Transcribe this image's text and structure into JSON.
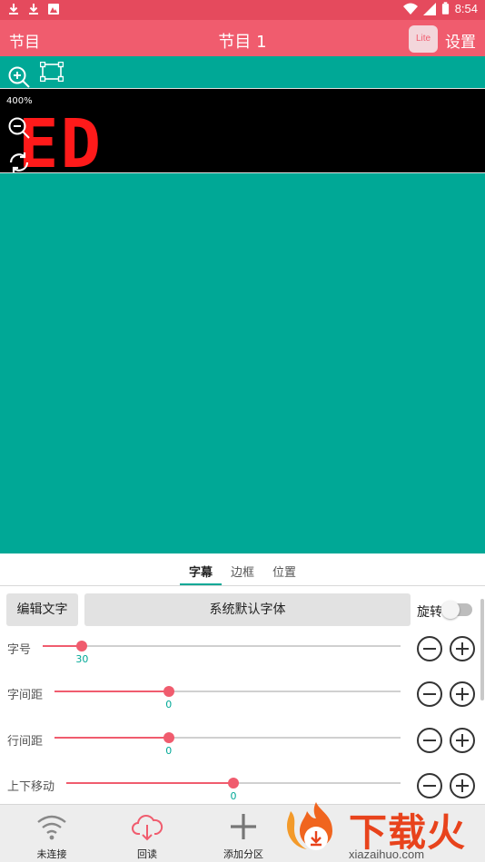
{
  "status_bar": {
    "time": "8:54",
    "left_icons": [
      "download-icon",
      "download-icon",
      "image-icon"
    ],
    "right_icons": [
      "wifi-icon",
      "signal-icon",
      "battery-icon"
    ]
  },
  "app_bar": {
    "left_title": "节目",
    "title": "节目 1",
    "lite_badge": "Lite",
    "settings_label": "设置",
    "color": "#f05c6e"
  },
  "editor": {
    "zoom_level": "400%",
    "preview_text": "ED",
    "background_color": "#00a896",
    "led_color": "#ff1a1a"
  },
  "tabs": [
    {
      "label": "字幕",
      "active": true
    },
    {
      "label": "边框",
      "active": false
    },
    {
      "label": "位置",
      "active": false
    }
  ],
  "panel": {
    "edit_text_button": "编辑文字",
    "font_button": "系统默认字体",
    "rotate_label": "旋转",
    "rotate_on": false,
    "rows": [
      {
        "label": "字号",
        "value": "30",
        "fraction": 0.11
      },
      {
        "label": "字间距",
        "value": "0",
        "fraction": 0.33
      },
      {
        "label": "行间距",
        "value": "0",
        "fraction": 0.33
      },
      {
        "label": "上下移动",
        "value": "0",
        "fraction": 0.5
      }
    ]
  },
  "bottom_nav": [
    {
      "label": "未连接",
      "icon": "wifi-icon"
    },
    {
      "label": "回读",
      "icon": "cloud-download-icon"
    },
    {
      "label": "添加分区",
      "icon": "plus-icon"
    }
  ],
  "watermark": {
    "text": "下载火",
    "subtext": "xiazaihuo.com"
  }
}
